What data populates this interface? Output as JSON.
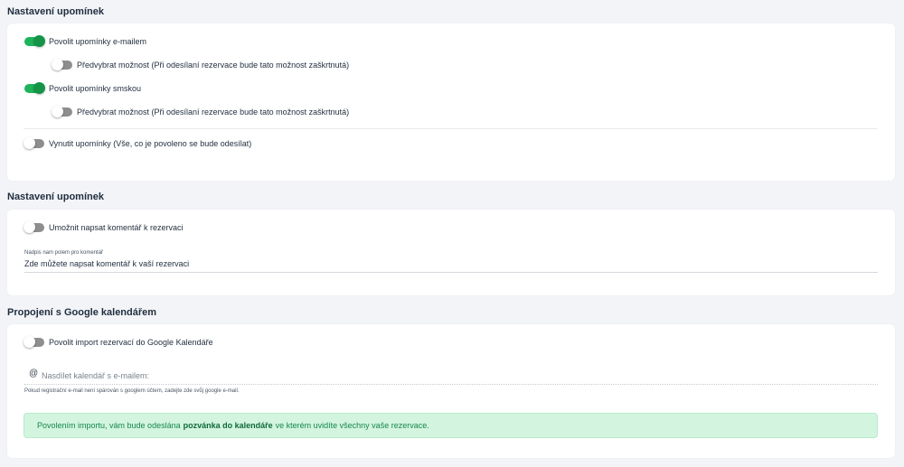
{
  "sections": [
    {
      "title": "Nastavení upomínek",
      "toggles": [
        {
          "label": "Povolit upomínky e-mailem",
          "on": true
        },
        {
          "label": "Předvybrat možnost (Při odesílaní rezervace bude tato možnost zaškrtnutá)",
          "on": false
        },
        {
          "label": "Povolit upomínky smskou",
          "on": true
        },
        {
          "label": "Předvybrat možnost (Při odesílaní rezervace bude tato možnost zaškrtnutá)",
          "on": false
        },
        {
          "label": "Vynutit upomínky (Vše, co je povoleno se bude odesílat)",
          "on": false
        }
      ]
    },
    {
      "title": "Nastavení upomínek",
      "toggle": {
        "label": "Umožnit napsat komentář k rezervaci",
        "on": false
      },
      "field": {
        "label": "Nadpis nam polem pro komentář",
        "value": "Zde můžete napsat komentář k vaší rezervaci"
      }
    },
    {
      "title": "Propojení s Google kalendářem",
      "toggle": {
        "label": "Povolit import rezervací do Google Kalendáře",
        "on": false
      },
      "share_field": {
        "icon": "at-icon",
        "placeholder": "Nasdílet kalendář s e-mailem:",
        "hint": "Pokud registrační e-mail není spárován s googlem účtem, zadejte zde svůj google e-mail."
      },
      "alert": {
        "before": "Povolením importu, vám bude odeslána",
        "bold": "pozvánka do kalendáře",
        "after": "ve kterém uvidíte všechny vaše rezervace."
      }
    }
  ],
  "colors": {
    "toggle_on": "#1fb35a",
    "toggle_off": "#8e8e8e",
    "alert_bg": "#d3f5df",
    "alert_text": "#16874a"
  }
}
